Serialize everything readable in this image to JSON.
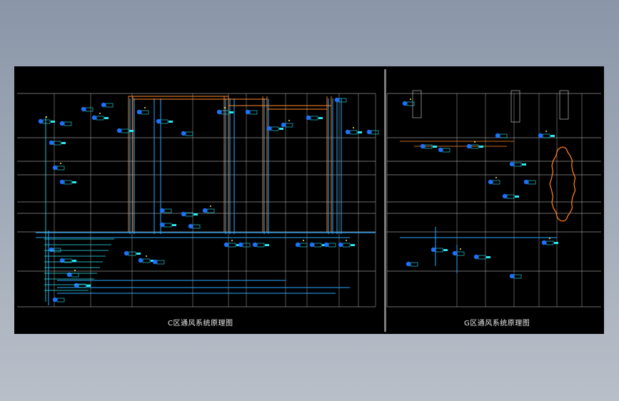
{
  "drawing": {
    "left_title": "C区通风系统原理图",
    "right_title": "G区通风系统原理图"
  },
  "colors": {
    "background": "#000000",
    "frame": "#8a96a8",
    "line_white": "#d8d8d8",
    "pipe_blue": "#2aa7ff",
    "pipe_cyan": "#2ee6f0",
    "pipe_orange": "#ff8a2a",
    "equipment_blue": "#1f6fff",
    "marker_yellow": "#ffe14a",
    "region_outline": "#ff7a1a"
  },
  "icons": [
    "valve-icon",
    "fan-icon",
    "damper-icon",
    "sensor-icon"
  ]
}
